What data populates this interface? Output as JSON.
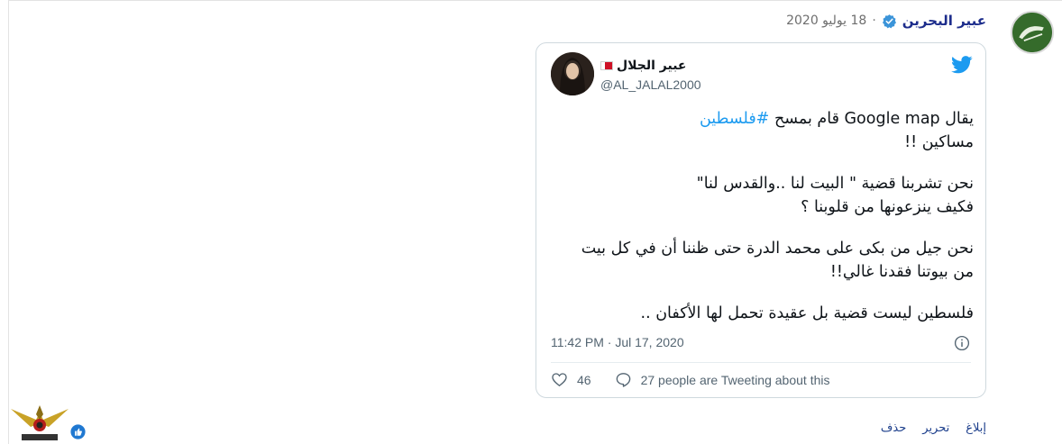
{
  "post": {
    "author": "عبير البحرين",
    "date": "18 يوليو 2020",
    "separator": "·"
  },
  "tweet": {
    "name": "عبير الجلال",
    "handle": "@AL_JALAL2000",
    "lines": {
      "l1_text": "يقال Google map قام بمسح",
      "l1_hashtag": "#فلسطين",
      "l2": "مساكين !!",
      "l3": "نحن تشربنا قضية \" البيت لنا ..والقدس لنا\"",
      "l4": "فكيف ينزعونها من قلوبنا ؟",
      "l5": "نحن جيل من بكى على محمد الدرة حتى ظننا أن في كل بيت",
      "l6": "من بيوتنا فقدنا غالي!!",
      "l7": "فلسطين ليست قضية بل عقيدة تحمل لها الأكفان .."
    },
    "timestamp": "11:42 PM · Jul 17, 2020",
    "likes": "46",
    "retweeting": "27 people are Tweeting about this"
  },
  "post_links": {
    "report": "إبلاغ",
    "edit": "تحرير",
    "delete": "حذف"
  },
  "colors": {
    "accent": "#1d9bf0",
    "author": "#1d2d8c",
    "link": "#1d3f8c"
  },
  "icons": [
    "verified-icon",
    "twitter-bird-icon",
    "info-icon",
    "heart-icon",
    "reply-bubble-icon",
    "like-badge-icon",
    "bahrain-flag-icon"
  ]
}
